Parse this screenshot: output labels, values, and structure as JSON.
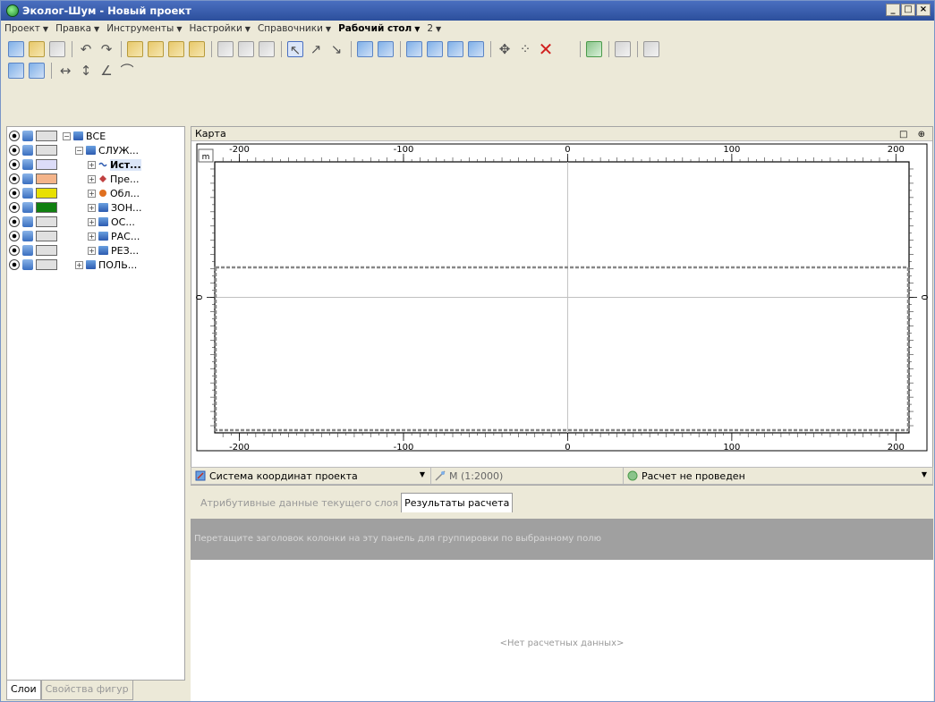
{
  "window": {
    "title": "Эколог-Шум - Новый проект",
    "buttons": [
      "_",
      "□",
      "×"
    ]
  },
  "menu": [
    {
      "label": "Проект",
      "bold": false
    },
    {
      "label": "Правка",
      "bold": false
    },
    {
      "label": "Инструменты",
      "bold": false
    },
    {
      "label": "Настройки",
      "bold": false
    },
    {
      "label": "Справочники",
      "bold": false
    },
    {
      "label": "Рабочий стол",
      "bold": true
    },
    {
      "label": "2",
      "bold": false
    }
  ],
  "layers": [
    {
      "label": "ВСЕ",
      "swatch": "#e0e0e0",
      "indent": 0,
      "expander": "−",
      "icon": "folder-icon",
      "selected": false
    },
    {
      "label": "СЛУЖ...",
      "swatch": "#e0e0e0",
      "indent": 1,
      "expander": "−",
      "icon": "folder-icon",
      "selected": false
    },
    {
      "label": "Ист...",
      "swatch": "#dcdcf8",
      "indent": 2,
      "expander": "+",
      "icon": "source-icon",
      "selected": true
    },
    {
      "label": "Пре...",
      "swatch": "#f4b48a",
      "indent": 2,
      "expander": "+",
      "icon": "obstacle-icon",
      "selected": false
    },
    {
      "label": "Обл...",
      "swatch": "#e8e000",
      "indent": 2,
      "expander": "+",
      "icon": "region-icon",
      "selected": false
    },
    {
      "label": "ЗОН...",
      "swatch": "#108010",
      "indent": 2,
      "expander": "+",
      "icon": "folder-icon",
      "selected": false
    },
    {
      "label": "ОС...",
      "swatch": "#e0e0e0",
      "indent": 2,
      "expander": "+",
      "icon": "folder-icon",
      "selected": false
    },
    {
      "label": "РАС...",
      "swatch": "#e0e0e0",
      "indent": 2,
      "expander": "+",
      "icon": "folder-icon",
      "selected": false
    },
    {
      "label": "РЕЗ...",
      "swatch": "#e0e0e0",
      "indent": 2,
      "expander": "+",
      "icon": "folder-icon",
      "selected": false
    },
    {
      "label": "ПОЛЬ...",
      "swatch": "#e0e0e0",
      "indent": 1,
      "expander": "+",
      "icon": "folder-icon",
      "selected": false
    }
  ],
  "left_tabs": [
    {
      "label": "Слои",
      "active": true
    },
    {
      "label": "Свойства фигур",
      "active": false
    }
  ],
  "map": {
    "title": "Карта",
    "controls": "□ ⊕",
    "corner_label": "m",
    "x_ticks": [
      -200,
      -100,
      0,
      100,
      200
    ],
    "x_range": [
      -215,
      208
    ],
    "y_ticks": [
      0
    ],
    "y_range": [
      -95,
      95
    ],
    "selection_y": [
      -15,
      95
    ]
  },
  "status": {
    "coordinate_system": "Система координат проекта",
    "scale": "M (1:2000)",
    "calc_status": "Расчет не проведен"
  },
  "bottom": {
    "tabs": [
      {
        "label": "Атрибутивные данные текущего слоя",
        "active": false
      },
      {
        "label": "Результаты расчета",
        "active": true
      }
    ],
    "group_hint": "Перетащите заголовок колонки на эту панель для группировки по выбранному полю",
    "empty": "<Нет расчетных данных>"
  }
}
